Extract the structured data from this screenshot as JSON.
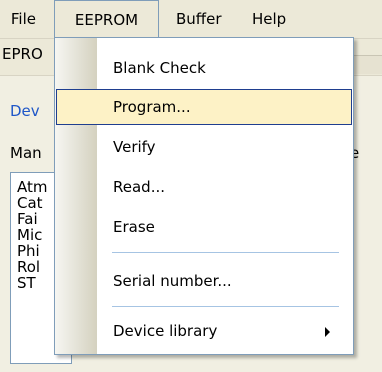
{
  "menubar": {
    "file": "File",
    "eeprom": "EEPROM",
    "buffer": "Buffer",
    "help": "Help"
  },
  "background": {
    "tab_label": "EPRO",
    "section_title": "Dev",
    "manufacturer_label": "Man",
    "right_label": "e",
    "manufacturers": [
      "Atm",
      "Cat",
      "Fai",
      "Mic",
      "Phi",
      "Rol",
      "ST"
    ]
  },
  "dropdown": {
    "blank_check": "Blank Check",
    "program": "Program...",
    "verify": "Verify",
    "read": "Read...",
    "erase": "Erase",
    "serial_number": "Serial number...",
    "device_library": "Device library"
  },
  "colors": {
    "highlight_bg": "#fdf2c6",
    "highlight_border": "#1f3e8f",
    "link_blue": "#1e56c8"
  }
}
